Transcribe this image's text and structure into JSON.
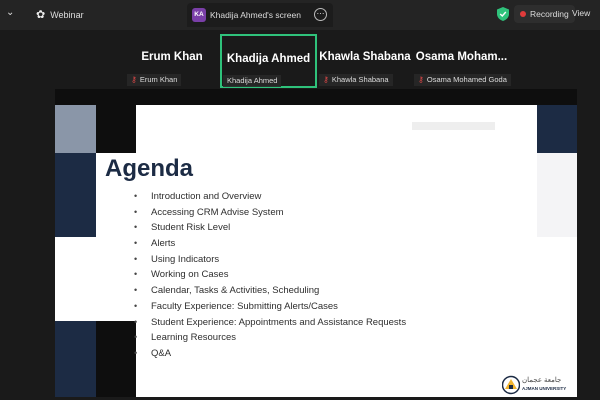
{
  "topbar": {
    "webinar_label": "Webinar",
    "screen_tab": {
      "badge": "KA",
      "title": "Khadija Ahmed's screen"
    },
    "recording_label": "Recording",
    "view_label": "View"
  },
  "participants": [
    {
      "name": "Erum Khan",
      "label": "Erum Khan",
      "muted": true,
      "active": false
    },
    {
      "name": "Khadija Ahmed",
      "label": "Khadija Ahmed",
      "muted": false,
      "active": true
    },
    {
      "name": "Khawla Shabana",
      "label": "Khawla Shabana",
      "muted": true,
      "active": false
    },
    {
      "name": "Osama  Moham...",
      "label": "Osama Mohamed Goda",
      "muted": true,
      "active": false
    }
  ],
  "slide": {
    "title": "Agenda",
    "items": [
      "Introduction and Overview",
      "Accessing CRM Advise System",
      "Student Risk Level",
      "Alerts",
      "Using Indicators",
      "Working on Cases",
      "Calendar, Tasks & Activities, Scheduling",
      "Faculty Experience: Submitting Alerts/Cases",
      "Student Experience: Appointments and Assistance Requests",
      "Learning Resources",
      "Q&A"
    ],
    "logo": {
      "arabic": "جامعة عجمان",
      "english": "AJMAN UNIVERSITY"
    }
  },
  "colors": {
    "accent_green": "#2fc27b",
    "navy": "#1c2b44",
    "recording_red": "#e03b3b"
  }
}
